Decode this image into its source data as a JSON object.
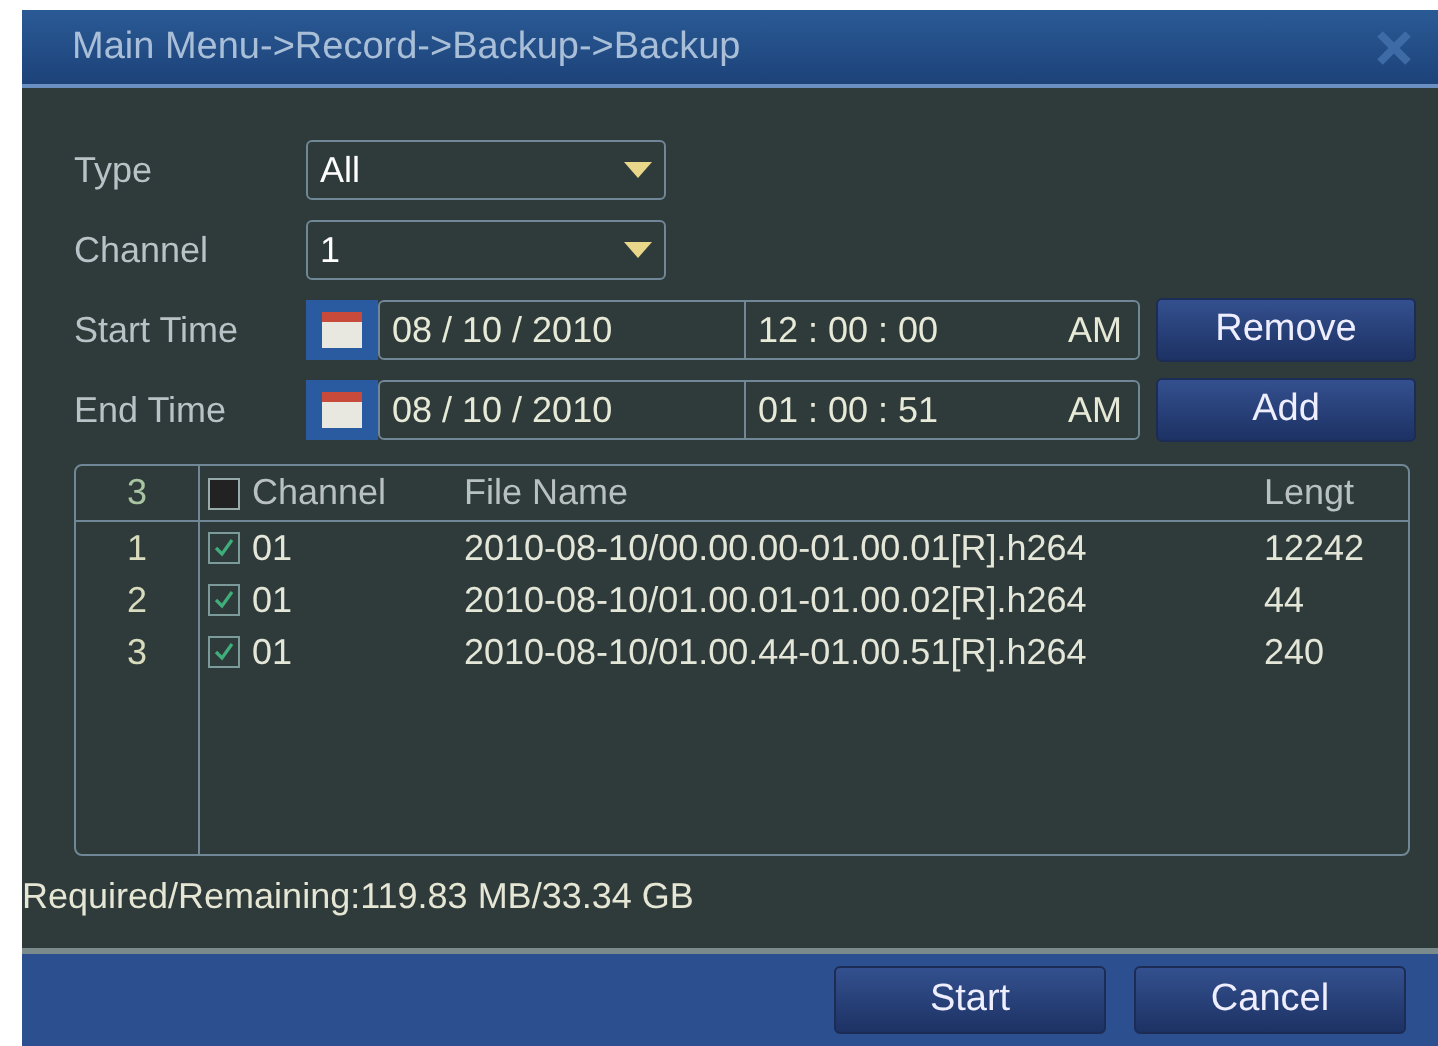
{
  "window": {
    "title": "Main Menu->Record->Backup->Backup"
  },
  "form": [
    {
      "kind": "select",
      "label": "Type",
      "value": "All"
    },
    {
      "kind": "select",
      "label": "Channel",
      "value": "1"
    },
    {
      "kind": "datetime",
      "label": "Start Time",
      "date": "08 / 10 / 2010",
      "time": "12 : 00 : 00",
      "ampm": "AM",
      "button": "Remove"
    },
    {
      "kind": "datetime",
      "label": "End Time",
      "date": "08 / 10 / 2010",
      "time": "01 : 00 : 51",
      "ampm": "AM",
      "button": "Add"
    }
  ],
  "table": {
    "count": "3",
    "select_all": false,
    "columns": [
      "Channel",
      "File Name",
      "Lengt"
    ],
    "rows": [
      {
        "index": "1",
        "checked": true,
        "channel": "01",
        "file": "2010-08-10/00.00.00-01.00.01[R].h264",
        "length": "12242"
      },
      {
        "index": "2",
        "checked": true,
        "channel": "01",
        "file": "2010-08-10/01.00.01-01.00.02[R].h264",
        "length": "44"
      },
      {
        "index": "3",
        "checked": true,
        "channel": "01",
        "file": "2010-08-10/01.00.44-01.00.51[R].h264",
        "length": "240"
      }
    ]
  },
  "status": "Required/Remaining:119.83 MB/33.34 GB",
  "buttons": [
    "Start",
    "Cancel"
  ]
}
